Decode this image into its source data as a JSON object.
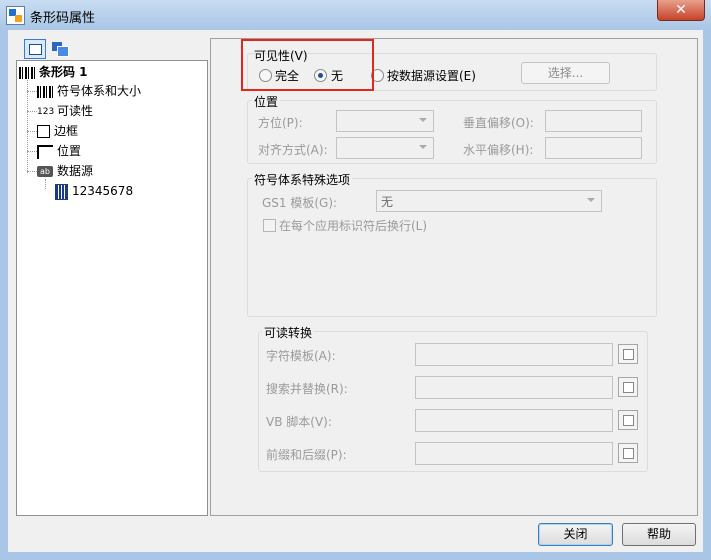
{
  "window": {
    "title": "条形码属性",
    "close_glyph": "✕"
  },
  "tree": {
    "root": "条形码 1",
    "items": [
      "符号体系和大小",
      "可读性",
      "边框",
      "位置",
      "数据源"
    ],
    "leaf": "12345678",
    "icon_123": "123",
    "icon_ab": "ab"
  },
  "visibility": {
    "title": "可见性(V)",
    "opt_full": "完全",
    "opt_none": "无",
    "opt_source": "按数据源设置(E)",
    "select_button": "选择...",
    "selected": "无"
  },
  "position": {
    "title": "位置",
    "orientation_label": "方位(P):",
    "alignment_label": "对齐方式(A):",
    "v_offset_label": "垂直偏移(O):",
    "h_offset_label": "水平偏移(H):"
  },
  "symbology_options": {
    "title": "符号体系特殊选项",
    "gs1_label": "GS1 模板(G):",
    "gs1_value": "无",
    "newline_label": "在每个应用标识符后换行(L)"
  },
  "readable_transform": {
    "title": "可读转换",
    "char_template": "字符模板(A):",
    "search_replace": "搜索并替换(R):",
    "vb_script": "VB 脚本(V):",
    "prefix_suffix": "前缀和后缀(P):"
  },
  "buttons": {
    "close": "关闭",
    "help": "帮助"
  }
}
